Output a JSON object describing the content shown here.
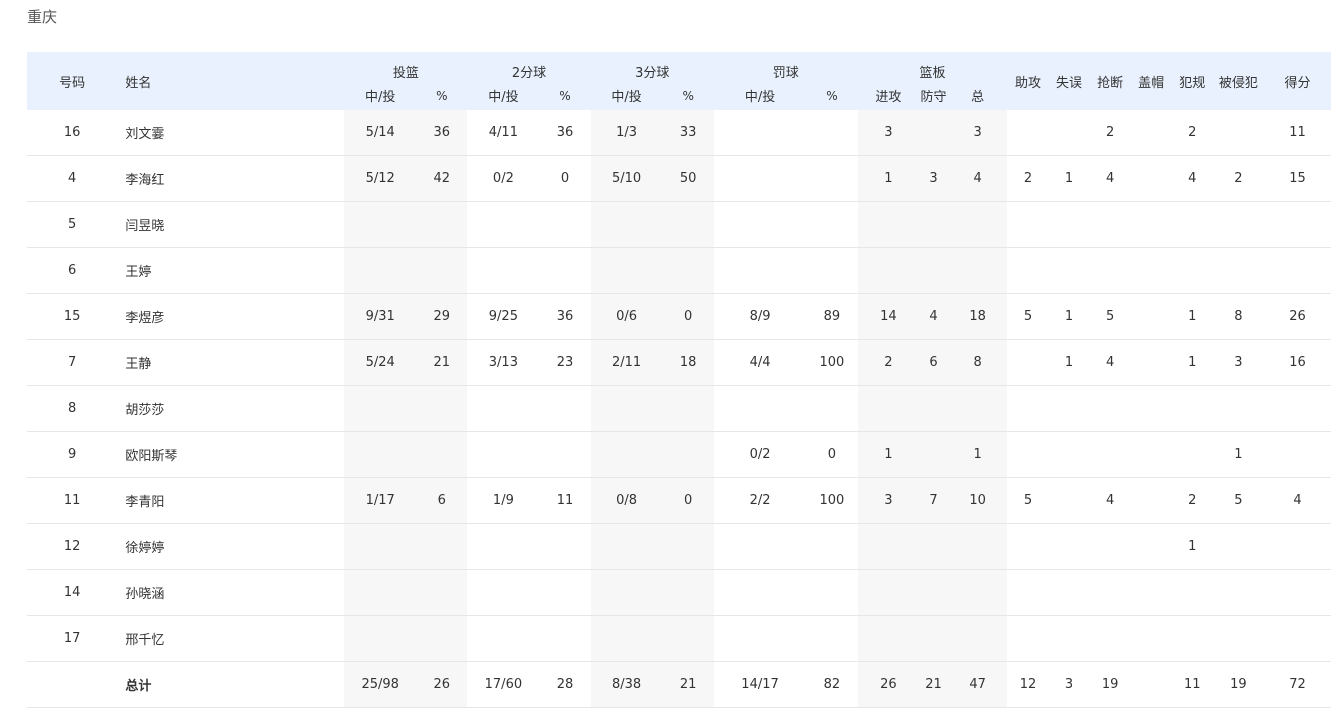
{
  "team": "重庆",
  "headers": {
    "number": "号码",
    "name": "姓名",
    "fg": "投篮",
    "two": "2分球",
    "three": "3分球",
    "ft": "罚球",
    "reb": "篮板",
    "made_att": "中/投",
    "pct": "%",
    "off": "进攻",
    "def": "防守",
    "tot": "总",
    "ast": "助攻",
    "to": "失误",
    "stl": "抢断",
    "blk": "盖帽",
    "pf": "犯规",
    "fd": "被侵犯",
    "pts": "得分"
  },
  "columns": [
    "num",
    "name",
    "fg",
    "fg_pct",
    "two",
    "two_pct",
    "three",
    "three_pct",
    "ft",
    "ft_pct",
    "off",
    "def",
    "tot",
    "ast",
    "to",
    "stl",
    "blk",
    "pf",
    "fd",
    "pts"
  ],
  "players": [
    {
      "num": "16",
      "name": "刘文霎",
      "fg": "5/14",
      "fg_pct": "36",
      "two": "4/11",
      "two_pct": "36",
      "three": "1/3",
      "three_pct": "33",
      "ft": "",
      "ft_pct": "",
      "off": "3",
      "def": "",
      "tot": "3",
      "ast": "",
      "to": "",
      "stl": "2",
      "blk": "",
      "pf": "2",
      "fd": "",
      "pts": "11"
    },
    {
      "num": "4",
      "name": "李海红",
      "fg": "5/12",
      "fg_pct": "42",
      "two": "0/2",
      "two_pct": "0",
      "three": "5/10",
      "three_pct": "50",
      "ft": "",
      "ft_pct": "",
      "off": "1",
      "def": "3",
      "tot": "4",
      "ast": "2",
      "to": "1",
      "stl": "4",
      "blk": "",
      "pf": "4",
      "fd": "2",
      "pts": "15"
    },
    {
      "num": "5",
      "name": "闫昱晓",
      "fg": "",
      "fg_pct": "",
      "two": "",
      "two_pct": "",
      "three": "",
      "three_pct": "",
      "ft": "",
      "ft_pct": "",
      "off": "",
      "def": "",
      "tot": "",
      "ast": "",
      "to": "",
      "stl": "",
      "blk": "",
      "pf": "",
      "fd": "",
      "pts": ""
    },
    {
      "num": "6",
      "name": "王婷",
      "fg": "",
      "fg_pct": "",
      "two": "",
      "two_pct": "",
      "three": "",
      "three_pct": "",
      "ft": "",
      "ft_pct": "",
      "off": "",
      "def": "",
      "tot": "",
      "ast": "",
      "to": "",
      "stl": "",
      "blk": "",
      "pf": "",
      "fd": "",
      "pts": ""
    },
    {
      "num": "15",
      "name": "李煜彦",
      "fg": "9/31",
      "fg_pct": "29",
      "two": "9/25",
      "two_pct": "36",
      "three": "0/6",
      "three_pct": "0",
      "ft": "8/9",
      "ft_pct": "89",
      "off": "14",
      "def": "4",
      "tot": "18",
      "ast": "5",
      "to": "1",
      "stl": "5",
      "blk": "",
      "pf": "1",
      "fd": "8",
      "pts": "26"
    },
    {
      "num": "7",
      "name": "王静",
      "fg": "5/24",
      "fg_pct": "21",
      "two": "3/13",
      "two_pct": "23",
      "three": "2/11",
      "three_pct": "18",
      "ft": "4/4",
      "ft_pct": "100",
      "off": "2",
      "def": "6",
      "tot": "8",
      "ast": "",
      "to": "1",
      "stl": "4",
      "blk": "",
      "pf": "1",
      "fd": "3",
      "pts": "16"
    },
    {
      "num": "8",
      "name": "胡莎莎",
      "fg": "",
      "fg_pct": "",
      "two": "",
      "two_pct": "",
      "three": "",
      "three_pct": "",
      "ft": "",
      "ft_pct": "",
      "off": "",
      "def": "",
      "tot": "",
      "ast": "",
      "to": "",
      "stl": "",
      "blk": "",
      "pf": "",
      "fd": "",
      "pts": ""
    },
    {
      "num": "9",
      "name": "欧阳斯琴",
      "fg": "",
      "fg_pct": "",
      "two": "",
      "two_pct": "",
      "three": "",
      "three_pct": "",
      "ft": "0/2",
      "ft_pct": "0",
      "off": "1",
      "def": "",
      "tot": "1",
      "ast": "",
      "to": "",
      "stl": "",
      "blk": "",
      "pf": "",
      "fd": "1",
      "pts": ""
    },
    {
      "num": "11",
      "name": "李青阳",
      "fg": "1/17",
      "fg_pct": "6",
      "two": "1/9",
      "two_pct": "11",
      "three": "0/8",
      "three_pct": "0",
      "ft": "2/2",
      "ft_pct": "100",
      "off": "3",
      "def": "7",
      "tot": "10",
      "ast": "5",
      "to": "",
      "stl": "4",
      "blk": "",
      "pf": "2",
      "fd": "5",
      "pts": "4"
    },
    {
      "num": "12",
      "name": "徐婷婷",
      "fg": "",
      "fg_pct": "",
      "two": "",
      "two_pct": "",
      "three": "",
      "three_pct": "",
      "ft": "",
      "ft_pct": "",
      "off": "",
      "def": "",
      "tot": "",
      "ast": "",
      "to": "",
      "stl": "",
      "blk": "",
      "pf": "1",
      "fd": "",
      "pts": ""
    },
    {
      "num": "14",
      "name": "孙晓涵",
      "fg": "",
      "fg_pct": "",
      "two": "",
      "two_pct": "",
      "three": "",
      "three_pct": "",
      "ft": "",
      "ft_pct": "",
      "off": "",
      "def": "",
      "tot": "",
      "ast": "",
      "to": "",
      "stl": "",
      "blk": "",
      "pf": "",
      "fd": "",
      "pts": ""
    },
    {
      "num": "17",
      "name": "邢千忆",
      "fg": "",
      "fg_pct": "",
      "two": "",
      "two_pct": "",
      "three": "",
      "three_pct": "",
      "ft": "",
      "ft_pct": "",
      "off": "",
      "def": "",
      "tot": "",
      "ast": "",
      "to": "",
      "stl": "",
      "blk": "",
      "pf": "",
      "fd": "",
      "pts": ""
    }
  ],
  "total": {
    "num": "",
    "name": "总计",
    "fg": "25/98",
    "fg_pct": "26",
    "two": "17/60",
    "two_pct": "28",
    "three": "8/38",
    "three_pct": "21",
    "ft": "14/17",
    "ft_pct": "82",
    "off": "26",
    "def": "21",
    "tot": "47",
    "ast": "12",
    "to": "3",
    "stl": "19",
    "blk": "",
    "pf": "11",
    "fd": "19",
    "pts": "72"
  }
}
